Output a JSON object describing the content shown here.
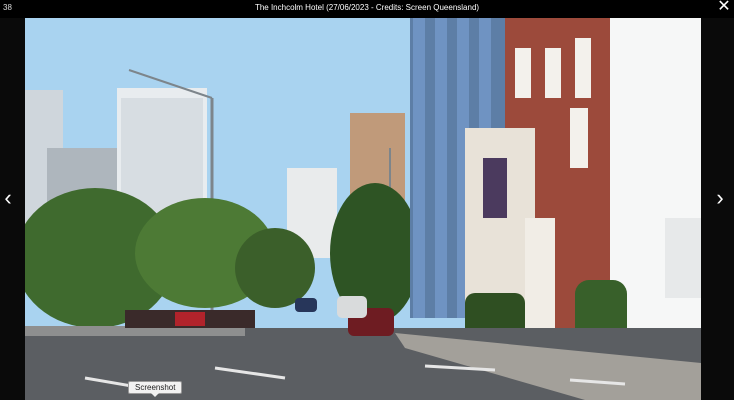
{
  "viewer": {
    "counter": "38",
    "caption": "The Inchcolm Hotel (27/06/2023 - Credits: Screen Queensland)",
    "close_icon": "close-icon",
    "prev_icon": "chevron-left-icon",
    "next_icon": "chevron-right-icon",
    "close_glyph": "✕",
    "prev_glyph": "‹",
    "next_glyph": "›"
  },
  "tooltip": {
    "label": "Screenshot"
  },
  "photo": {
    "subject": "street-scene"
  }
}
